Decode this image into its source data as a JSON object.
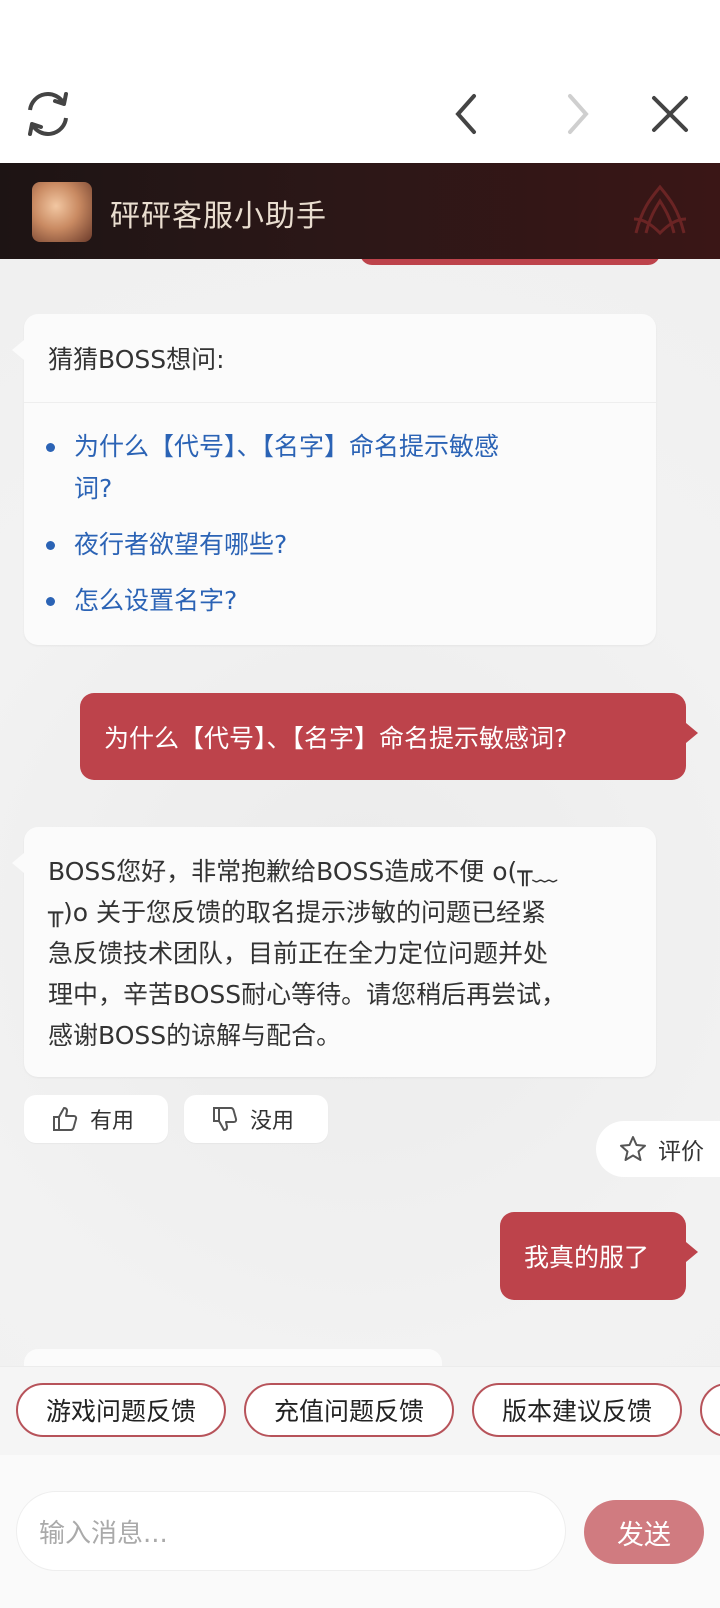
{
  "header": {
    "title": "砰砰客服小助手"
  },
  "suggestions": {
    "title": "猜猜BOSS想问:",
    "items": [
      {
        "line1": "为什么【代号】、【名字】命名提示敏感",
        "line2": "词?"
      },
      {
        "line1": "夜行者欲望有哪些?"
      },
      {
        "line1": "怎么设置名字?"
      }
    ]
  },
  "messages": {
    "user1": "为什么【代号】、【名字】命名提示敏感词?",
    "bot_reply": [
      "BOSS您好，非常抱歉给BOSS造成不便 o(╥﹏",
      "╥)o 关于您反馈的取名提示涉敏的问题已经紧",
      "急反馈技术团队，目前正在全力定位问题并处",
      "理中，辛苦BOSS耐心等待。请您稍后再尝试，",
      "感谢BOSS的谅解与配合。"
    ],
    "user2": "我真的服了"
  },
  "feedback": {
    "useful": "有用",
    "useless": "没用",
    "rate": "评价"
  },
  "quick_replies": [
    "游戏问题反馈",
    "充值问题反馈",
    "版本建议反馈"
  ],
  "composer": {
    "placeholder": "输入消息...",
    "send": "发送"
  },
  "colors": {
    "accent": "#bd434b",
    "link": "#2b63b5",
    "send_disabled": "#d07b80"
  }
}
